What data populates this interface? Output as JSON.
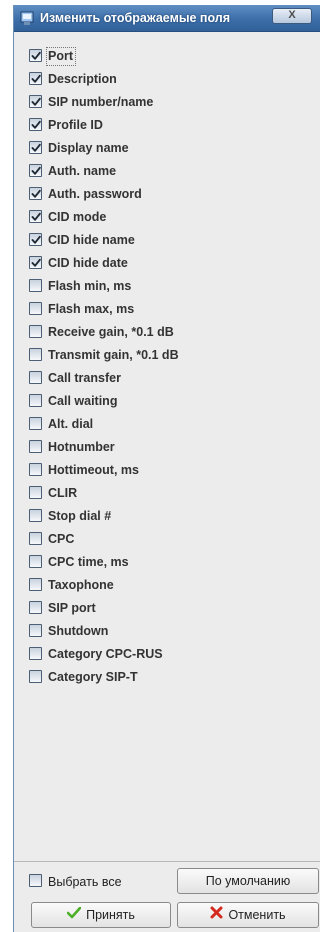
{
  "window": {
    "title": "Изменить отображаемые поля",
    "close_label": "X"
  },
  "fields": [
    {
      "label": "Port",
      "checked": true
    },
    {
      "label": "Description",
      "checked": true
    },
    {
      "label": "SIP number/name",
      "checked": true
    },
    {
      "label": "Profile ID",
      "checked": true
    },
    {
      "label": "Display name",
      "checked": true
    },
    {
      "label": "Auth. name",
      "checked": true
    },
    {
      "label": "Auth. password",
      "checked": true
    },
    {
      "label": "CID mode",
      "checked": true
    },
    {
      "label": "CID hide name",
      "checked": true
    },
    {
      "label": "CID hide date",
      "checked": true
    },
    {
      "label": "Flash min, ms",
      "checked": false
    },
    {
      "label": "Flash max, ms",
      "checked": false
    },
    {
      "label": "Receive gain, *0.1 dB",
      "checked": false
    },
    {
      "label": "Transmit gain, *0.1 dB",
      "checked": false
    },
    {
      "label": "Call transfer",
      "checked": false
    },
    {
      "label": "Call waiting",
      "checked": false
    },
    {
      "label": "Alt. dial",
      "checked": false
    },
    {
      "label": "Hotnumber",
      "checked": false
    },
    {
      "label": "Hottimeout, ms",
      "checked": false
    },
    {
      "label": "CLIR",
      "checked": false
    },
    {
      "label": "Stop dial #",
      "checked": false
    },
    {
      "label": "CPC",
      "checked": false
    },
    {
      "label": "CPC time, ms",
      "checked": false
    },
    {
      "label": "Taxophone",
      "checked": false
    },
    {
      "label": "SIP port",
      "checked": false
    },
    {
      "label": "Shutdown",
      "checked": false
    },
    {
      "label": "Category CPC-RUS",
      "checked": false
    },
    {
      "label": "Category SIP-T",
      "checked": false
    }
  ],
  "footer": {
    "select_all_label": "Выбрать все",
    "select_all_checked": false,
    "default_label": "По умолчанию",
    "accept_label": "Принять",
    "cancel_label": "Отменить"
  },
  "icons": {
    "window": "window-app-icon",
    "accept": "check-icon",
    "cancel": "red-x-icon"
  },
  "colors": {
    "titlebar": "#3c6ea8",
    "accept_icon": "#4caf28",
    "cancel_icon": "#d42a1e"
  }
}
